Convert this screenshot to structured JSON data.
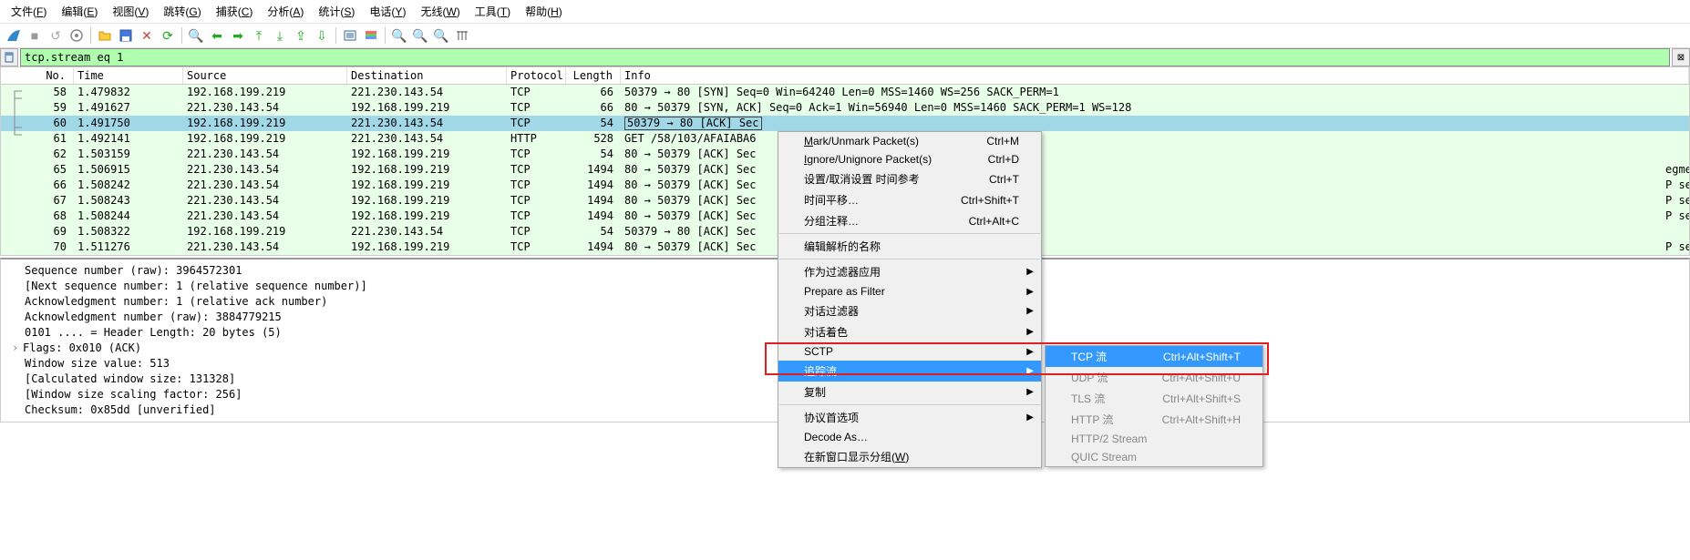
{
  "menubar": [
    "文件(F)",
    "编辑(E)",
    "视图(V)",
    "跳转(G)",
    "捕获(C)",
    "分析(A)",
    "统计(S)",
    "电话(Y)",
    "无线(W)",
    "工具(T)",
    "帮助(H)"
  ],
  "filter": {
    "value": "tcp.stream eq 1"
  },
  "columns": {
    "no": "No.",
    "time": "Time",
    "src": "Source",
    "dst": "Destination",
    "proto": "Protocol",
    "len": "Length",
    "info": "Info"
  },
  "rows": [
    {
      "no": "58",
      "time": "1.479832",
      "src": "192.168.199.219",
      "dst": "221.230.143.54",
      "proto": "TCP",
      "len": "66",
      "info": "50379 → 80 [SYN] Seq=0 Win=64240 Len=0 MSS=1460 WS=256 SACK_PERM=1"
    },
    {
      "no": "59",
      "time": "1.491627",
      "src": "221.230.143.54",
      "dst": "192.168.199.219",
      "proto": "TCP",
      "len": "66",
      "info": "80 → 50379 [SYN, ACK] Seq=0 Ack=1 Win=56940 Len=0 MSS=1460 SACK_PERM=1 WS=128"
    },
    {
      "no": "60",
      "time": "1.491750",
      "src": "192.168.199.219",
      "dst": "221.230.143.54",
      "proto": "TCP",
      "len": "54",
      "info": "50379 → 80 [ACK] Sec",
      "selected": true,
      "boxed": true
    },
    {
      "no": "61",
      "time": "1.492141",
      "src": "192.168.199.219",
      "dst": "221.230.143.54",
      "proto": "HTTP",
      "len": "528",
      "info": "GET /58/103/AFAIABA6"
    },
    {
      "no": "62",
      "time": "1.503159",
      "src": "221.230.143.54",
      "dst": "192.168.199.219",
      "proto": "TCP",
      "len": "54",
      "info": "80 → 50379 [ACK] Sec"
    },
    {
      "no": "65",
      "time": "1.506915",
      "src": "221.230.143.54",
      "dst": "192.168.199.219",
      "proto": "TCP",
      "len": "1494",
      "info": "80 → 50379 [ACK] Sec",
      "tail": "egment of a reassembled PDU]"
    },
    {
      "no": "66",
      "time": "1.508242",
      "src": "221.230.143.54",
      "dst": "192.168.199.219",
      "proto": "TCP",
      "len": "1494",
      "info": "80 → 50379 [ACK] Sec",
      "tail": "P segment of a reassembled PDU]"
    },
    {
      "no": "67",
      "time": "1.508243",
      "src": "221.230.143.54",
      "dst": "192.168.199.219",
      "proto": "TCP",
      "len": "1494",
      "info": "80 → 50379 [ACK] Sec",
      "tail": "P segment of a reassembled PDU]"
    },
    {
      "no": "68",
      "time": "1.508244",
      "src": "221.230.143.54",
      "dst": "192.168.199.219",
      "proto": "TCP",
      "len": "1494",
      "info": "80 → 50379 [ACK] Sec",
      "tail": "P segment of a reassembled PDU]"
    },
    {
      "no": "69",
      "time": "1.508322",
      "src": "192.168.199.219",
      "dst": "221.230.143.54",
      "proto": "TCP",
      "len": "54",
      "info": "50379 → 80 [ACK] Sec"
    },
    {
      "no": "70",
      "time": "1.511276",
      "src": "221.230.143.54",
      "dst": "192.168.199.219",
      "proto": "TCP",
      "len": "1494",
      "info": "80 → 50379 [ACK] Sec",
      "tail": "P segment of a reassembled PDU]"
    }
  ],
  "details": [
    "Sequence number (raw): 3964572301",
    "[Next sequence number: 1    (relative sequence number)]",
    "Acknowledgment number: 1    (relative ack number)",
    "Acknowledgment number (raw): 3884779215",
    "0101 .... = Header Length: 20 bytes (5)",
    "Flags: 0x010 (ACK)",
    "Window size value: 513",
    "[Calculated window size: 131328]",
    "[Window size scaling factor: 256]",
    "Checksum: 0x85dd [unverified]"
  ],
  "details_expander_index": 5,
  "context_menu": {
    "items": [
      {
        "label": "Mark/Unmark Packet(s)",
        "shortcut": "Ctrl+M",
        "u": 0
      },
      {
        "label": "Ignore/Unignore Packet(s)",
        "shortcut": "Ctrl+D",
        "u": 0
      },
      {
        "label": "设置/取消设置 时间参考",
        "shortcut": "Ctrl+T"
      },
      {
        "label": "时间平移…",
        "shortcut": "Ctrl+Shift+T"
      },
      {
        "label": "分组注释…",
        "shortcut": "Ctrl+Alt+C"
      },
      {
        "sep": true
      },
      {
        "label": "编辑解析的名称"
      },
      {
        "sep": true
      },
      {
        "label": "作为过滤器应用",
        "arrow": true
      },
      {
        "label": "Prepare as Filter",
        "arrow": true
      },
      {
        "label": "对话过滤器",
        "arrow": true
      },
      {
        "label": "对话着色",
        "arrow": true
      },
      {
        "label": "SCTP",
        "arrow": true
      },
      {
        "label": "追踪流",
        "arrow": true,
        "highlighted": true
      },
      {
        "label": "复制",
        "arrow": true
      },
      {
        "sep": true
      },
      {
        "label": "协议首选项",
        "arrow": true
      },
      {
        "label": "Decode As…"
      },
      {
        "label": "在新窗口显示分组(W)",
        "u": 9
      }
    ]
  },
  "submenu": {
    "items": [
      {
        "label": "TCP 流",
        "shortcut": "Ctrl+Alt+Shift+T",
        "highlighted": true
      },
      {
        "label": "UDP 流",
        "shortcut": "Ctrl+Alt+Shift+U",
        "disabled": true
      },
      {
        "label": "TLS 流",
        "shortcut": "Ctrl+Alt+Shift+S",
        "disabled": true
      },
      {
        "label": "HTTP 流",
        "shortcut": "Ctrl+Alt+Shift+H",
        "disabled": true
      },
      {
        "label": "HTTP/2 Stream",
        "disabled": true
      },
      {
        "label": "QUIC Stream",
        "disabled": true
      }
    ]
  }
}
